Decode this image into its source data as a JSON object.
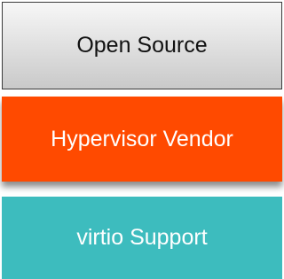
{
  "stack": {
    "blocks": [
      {
        "label": "Open Source",
        "color": "#d9d9d9"
      },
      {
        "label": "Hypervisor Vendor",
        "color": "#ff4a00"
      },
      {
        "label": "virtio Support",
        "color": "#3dbcbe"
      }
    ]
  }
}
